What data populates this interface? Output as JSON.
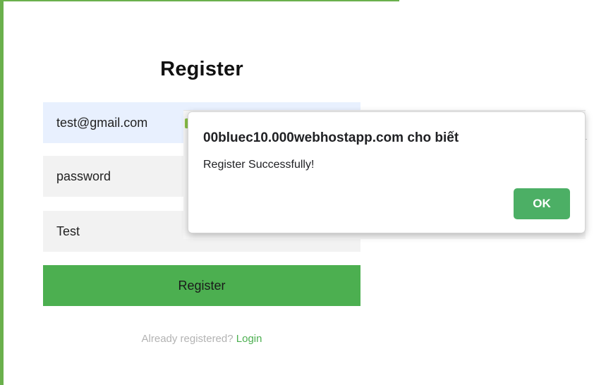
{
  "form": {
    "title": "Register",
    "email_value": "test@gmail.com",
    "password_value": "password",
    "name_value": "Test",
    "submit_label": "Register",
    "already_text": "Already registered?",
    "login_link": "Login"
  },
  "dialog": {
    "title": "00bluec10.000webhostapp.com cho biết",
    "message": "Register Successfully!",
    "ok_label": "OK"
  },
  "colors": {
    "accent_green": "#4caf50",
    "border_green": "#6ab04c",
    "autofill_blue": "#e8f0fe",
    "field_gray": "#f2f2f2"
  }
}
